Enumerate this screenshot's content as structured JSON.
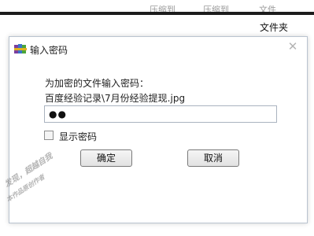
{
  "background_window": {
    "partial_labels": [
      "压缩到",
      "压缩到",
      "文件"
    ],
    "folder_label": "文件夹"
  },
  "dialog": {
    "title": "输入密码",
    "prompt": "为加密的文件输入密码：",
    "file_path": "百度经验记录\\7月份经验提现.jpg",
    "password_value": "●●",
    "show_password_label": "显示密码",
    "show_password_checked": false,
    "ok_label": "确定",
    "cancel_label": "取消",
    "close_glyph": "✕"
  },
  "watermark": {
    "line1": "发现，超越自我",
    "line2": "本作品原创作者"
  },
  "colors": {
    "dialog_border": "#b9c3cf",
    "topbar_line": "#1c1c1c",
    "close_icon": "#b4b4b4"
  },
  "icons": {
    "app": "winrar-books-icon",
    "close": "close-icon"
  }
}
